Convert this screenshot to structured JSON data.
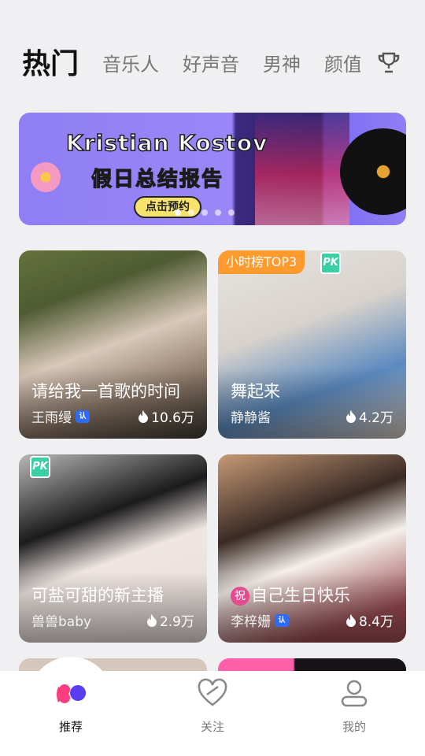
{
  "tabs": [
    "热门",
    "音乐人",
    "好声音",
    "男神",
    "颜值"
  ],
  "trophy_icon": "trophy-icon",
  "banner": {
    "title": "Kristian Kostov",
    "subtitle": "假日总结报告",
    "button": "点击预约",
    "slides": 5,
    "current_slide": 1
  },
  "cards": [
    {
      "title": "请给我一首歌的时间",
      "name": "王雨缦",
      "verified": true,
      "views": "10.6万",
      "pk": false,
      "rank_badge": ""
    },
    {
      "title": "舞起来",
      "name": "静静酱",
      "verified": false,
      "views": "4.2万",
      "pk": true,
      "rank_badge": "小时榜TOP3"
    },
    {
      "title": "可盐可甜的新主播",
      "name": "兽兽baby",
      "verified": false,
      "views": "2.9万",
      "pk": true,
      "rank_badge": ""
    },
    {
      "title": "自己生日快乐",
      "wish_badge": "祝",
      "name": "李梓姗",
      "verified": true,
      "views": "8.4万",
      "pk": false,
      "rank_badge": ""
    }
  ],
  "bottom_nav": [
    {
      "label": "推荐",
      "icon": "recommend-icon",
      "active": true
    },
    {
      "label": "关注",
      "icon": "follow-heart-icon",
      "active": false
    },
    {
      "label": "我的",
      "icon": "profile-icon",
      "active": false
    }
  ],
  "colors": {
    "rank_badge": "#ff9a2e",
    "pk_badge": "#3ad0a5",
    "verified_badge": "#2d6cf6",
    "accent_pink": "#ff3d7f",
    "accent_purple": "#5a3df2"
  }
}
